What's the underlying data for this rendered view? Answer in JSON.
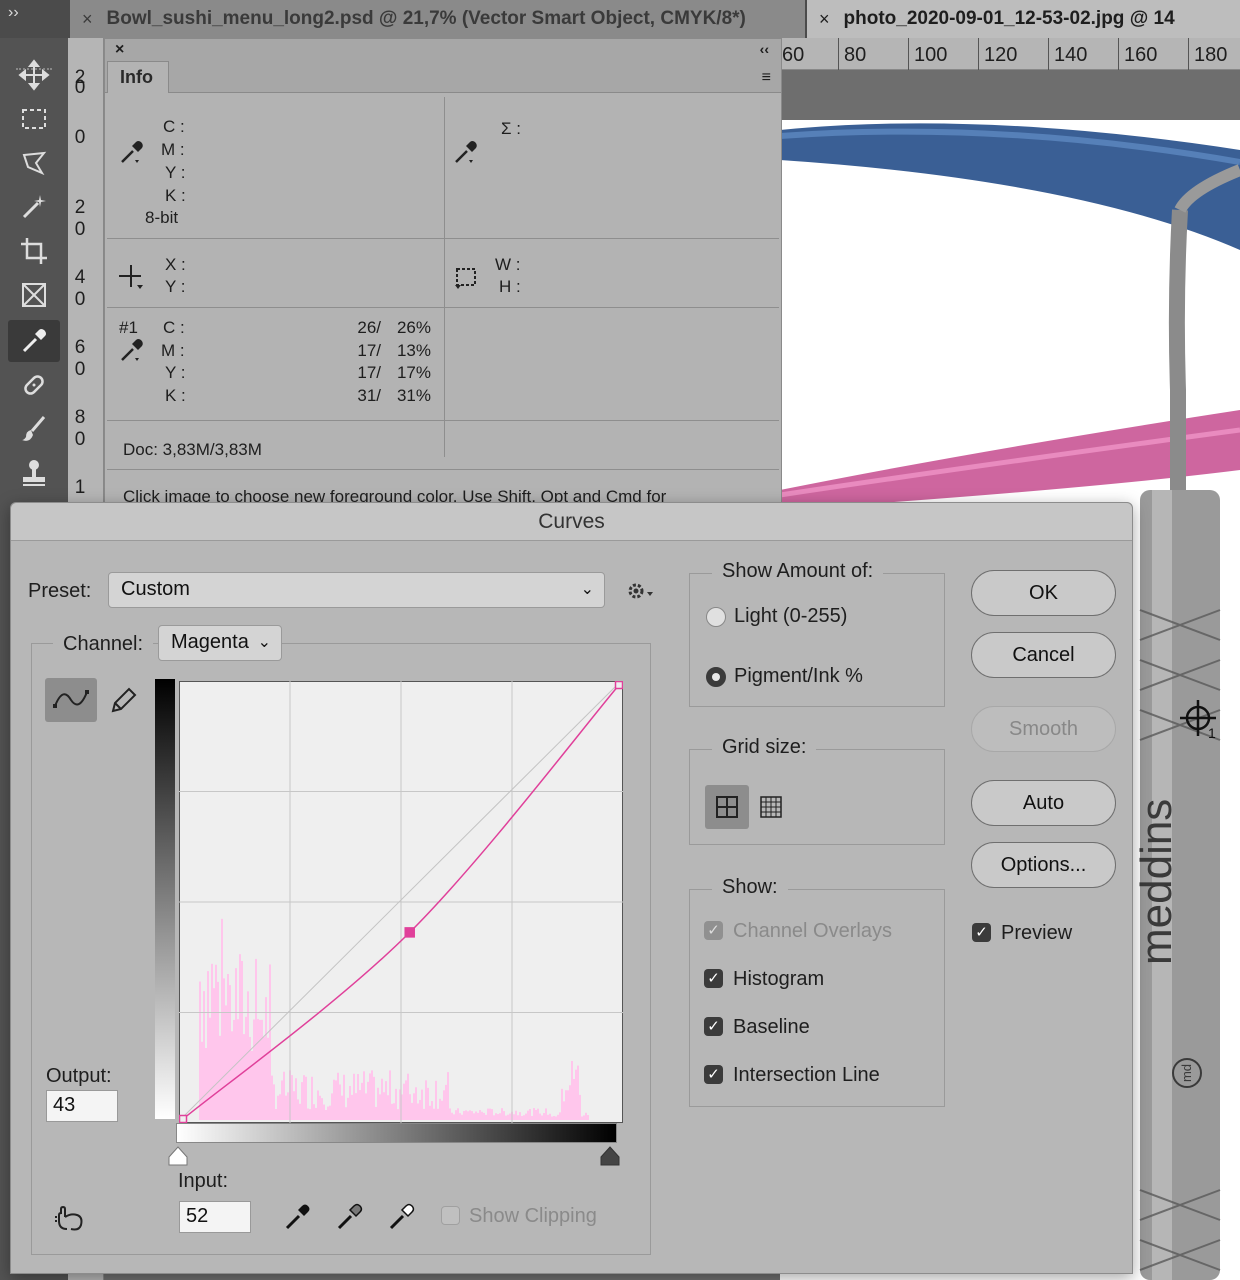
{
  "tabs": [
    {
      "label": "Bowl_sushi_menu_long2.psd @ 21,7% (Vector Smart Object, CMYK/8*)",
      "close": "×"
    },
    {
      "label": "photo_2020-09-01_12-53-02.jpg @ 14",
      "close": "×"
    }
  ],
  "toolbar_collapse": "››",
  "toolbar": {
    "tools": [
      "move-tool",
      "marquee-tool",
      "lasso-tool",
      "magic-wand-tool",
      "crop-tool",
      "frame-tool",
      "eyedropper-tool",
      "healing-brush-tool",
      "brush-tool",
      "clone-stamp-tool"
    ],
    "active": "eyedropper-tool"
  },
  "vruler": [
    "2",
    "0",
    "0",
    "2",
    "0",
    "4",
    "0",
    "6",
    "0",
    "8",
    "0",
    "1"
  ],
  "hruler": [
    "60",
    "80",
    "100",
    "120",
    "140",
    "160",
    "180"
  ],
  "info": {
    "tab": "Info",
    "close": "×",
    "collapse": "‹‹",
    "menu": "≡",
    "cmyk_labels": [
      "C :",
      "M :",
      "Y :",
      "K :"
    ],
    "bit_depth": "8-bit",
    "sum_label": "Σ :",
    "xy_labels": [
      "X :",
      "Y :"
    ],
    "wh_labels": [
      "W :",
      "H :"
    ],
    "sampler": {
      "id": "#1",
      "rows": [
        {
          "label": "C :",
          "before": "26/",
          "after": "26%"
        },
        {
          "label": "M :",
          "before": "17/",
          "after": "13%"
        },
        {
          "label": "Y :",
          "before": "17/",
          "after": "17%"
        },
        {
          "label": "K :",
          "before": "31/",
          "after": "31%"
        }
      ]
    },
    "doc": "Doc: 3,83M/3,83M",
    "hint": "Click image to choose new foreground color.  Use Shift, Opt and Cmd for"
  },
  "curves": {
    "title": "Curves",
    "preset_label": "Preset:",
    "preset_value": "Custom",
    "channel_label": "Channel:",
    "channel_value": "Magenta",
    "output_label": "Output:",
    "output_value": "43",
    "input_label": "Input:",
    "input_value": "52",
    "show_clipping": "Show Clipping",
    "curve_color": "#e0409a",
    "histogram_color": "#ffc6ec",
    "curve_points": [
      {
        "input": 0,
        "output": 0
      },
      {
        "input": 52,
        "output": 43
      },
      {
        "input": 100,
        "output": 100
      }
    ],
    "show_amount": {
      "title": "Show Amount of:",
      "options": [
        "Light  (0-255)",
        "Pigment/Ink %"
      ],
      "selected": 1
    },
    "grid_size": {
      "title": "Grid size:",
      "selected": "simple"
    },
    "show": {
      "title": "Show:",
      "items": [
        {
          "label": "Channel Overlays",
          "checked": true,
          "disabled": true
        },
        {
          "label": "Histogram",
          "checked": true,
          "disabled": false
        },
        {
          "label": "Baseline",
          "checked": true,
          "disabled": false
        },
        {
          "label": "Intersection Line",
          "checked": true,
          "disabled": false
        }
      ]
    },
    "buttons": {
      "ok": "OK",
      "cancel": "Cancel",
      "smooth": "Smooth",
      "auto": "Auto",
      "options": "Options..."
    },
    "preview_label": "Preview",
    "check_glyph": "✓"
  },
  "canvas": {
    "brand_text": "meddins",
    "brand_logo_text": "md",
    "target_index": "1"
  }
}
